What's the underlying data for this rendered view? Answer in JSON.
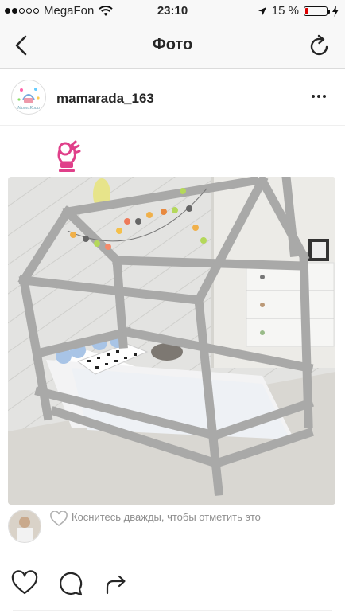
{
  "status_bar": {
    "carrier": "MegaFon",
    "time": "23:10",
    "battery_percent": "15 %",
    "signal_bars_filled": 2,
    "signal_bars_total": 5,
    "battery_level": 0.15,
    "icons": [
      "wifi-icon",
      "location-arrow-icon",
      "charging-bolt-icon"
    ]
  },
  "navbar": {
    "title": "Фото",
    "back_icon": "chevron-left-icon",
    "refresh_icon": "refresh-icon"
  },
  "post": {
    "username": "mamarada_163",
    "avatar_label": "MamaRada",
    "options_icon": "more-dots-icon",
    "sticker_icon": "ok-hand-emoji-icon",
    "photo_description_icon": "house-bed-photo"
  },
  "like_hint": {
    "text": "Коснитесь дважды, чтобы отметить это",
    "icon": "heart-outline-icon"
  },
  "actions": {
    "like_icon": "heart-icon",
    "comment_icon": "comment-icon",
    "share_icon": "share-arrow-icon"
  },
  "colors": {
    "accent_red_battery": "#dd0000",
    "text_primary": "#262626",
    "text_secondary": "#8e8e8e",
    "sticker_pink": "#e0408a"
  }
}
